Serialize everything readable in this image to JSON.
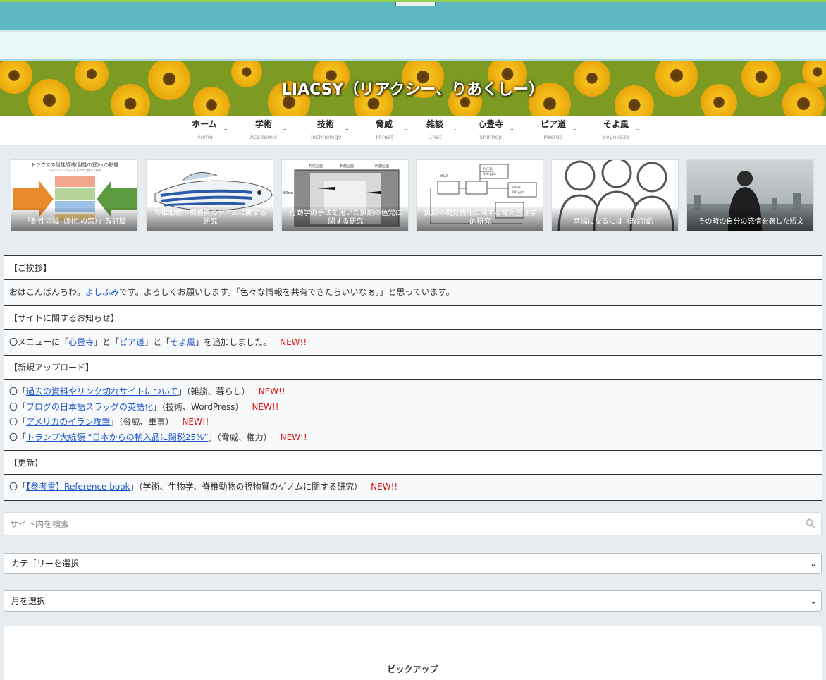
{
  "site": {
    "title": "LIACSY（リアクシー、りあくしー）"
  },
  "nav": [
    {
      "jp": "ホーム",
      "en": "Home"
    },
    {
      "jp": "学術",
      "en": "Academic"
    },
    {
      "jp": "技術",
      "en": "Technology"
    },
    {
      "jp": "脅威",
      "en": "Threat"
    },
    {
      "jp": "雑談",
      "en": "Chat"
    },
    {
      "jp": "心豊寺",
      "en": "Shinhoji"
    },
    {
      "jp": "ピア道",
      "en": "Peerdo"
    },
    {
      "jp": "そよ風",
      "en": "Soyokaze"
    }
  ],
  "carousel": [
    {
      "caption": "「耐性領域（耐性の窓）」改訂版"
    },
    {
      "caption": "脊椎動物の視物質のゲノムに関する研究"
    },
    {
      "caption": "行動学的手法を用いた魚類の色覚に関する研究"
    },
    {
      "caption": "魚類の視覚機能に関する電気生理学的研究"
    },
    {
      "caption": "幸福になるには（改訂版）"
    },
    {
      "caption": "その時の自分の感情を表した短文"
    }
  ],
  "thumb_text": {
    "trauma_title": "トラウマの耐性領域(耐性の窓)への影響",
    "trauma_sub": "トラウマインフォームドケアに関する研究",
    "behavior_a": "判定区画",
    "behavior_b": "刺激区画",
    "behavior_c": "刺激区画",
    "behavior_dim": "60cm",
    "electro_a": "PA138",
    "electro_b": "100 ppm",
    "electro_c": "MSVF",
    "electro_d": "PA038",
    "electro_e": "100 ppm"
  },
  "notice": {
    "greeting_header": "【ご挨拶】",
    "greeting_pre": "おはこんばんちわ。",
    "greeting_link": "よしふみ",
    "greeting_post": "です。よろしくお願いします。「色々な情報を共有できたらいいなぁ。」と思っています。",
    "site_header": "【サイトに関するお知らせ】",
    "site_pre": "〇メニューに「",
    "site_link1": "心豊寺",
    "site_mid1": "」と「",
    "site_link2": "ピア道",
    "site_mid2": "」と「",
    "site_link3": "そよ風",
    "site_post": "」を追加しました。",
    "new_label": "NEW!!",
    "upload_header": "【新規アップロード】",
    "uploads": [
      {
        "prefix": "〇「",
        "link": "過去の資料やリンク切れサイトについて",
        "suffix": "」（雑談、暮らし）"
      },
      {
        "prefix": "〇「",
        "link": "ブログの日本語スラッグの英語化",
        "suffix": "」（技術、WordPress）"
      },
      {
        "prefix": "〇「",
        "link": "アメリカのイラン攻撃",
        "suffix": "」（脅威、軍事）"
      },
      {
        "prefix": "〇「",
        "link": "トランプ大統領 “日本からの輸入品に関税25%”",
        "suffix": "」（脅威、権力）"
      }
    ],
    "update_header": "【更新】",
    "update_prefix": "〇「",
    "update_link": "【参考書】Reference book",
    "update_suffix": "」（学術、生物学、脊椎動物の視物質のゲノムに関する研究）"
  },
  "search": {
    "placeholder": "サイト内を検索"
  },
  "category_select": {
    "value": "カテゴリーを選択"
  },
  "month_select": {
    "value": "月を選択"
  },
  "pickup": {
    "label": "ピックアップ"
  },
  "colors": {
    "topbar": "#5fb8c2",
    "accent_green": "#8fd04d",
    "link": "#1b56c8",
    "new": "#e01010"
  }
}
